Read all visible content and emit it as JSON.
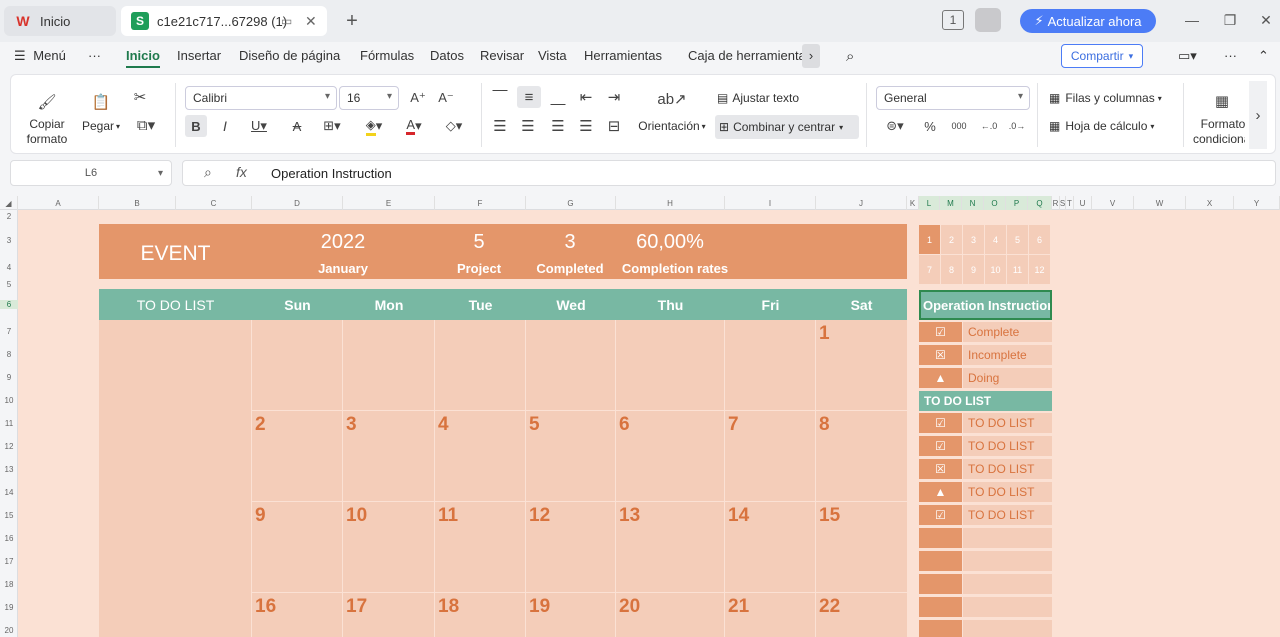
{
  "tabs": {
    "home_label": "Inicio",
    "doc_label": "c1e21c717...67298 (1)",
    "update_label": "Actualizar ahora"
  },
  "menu": {
    "menu_label": "Menú",
    "more": "···",
    "items": [
      "Inicio",
      "Insertar",
      "Diseño de página",
      "Fórmulas",
      "Datos",
      "Revisar",
      "Vista",
      "Herramientas",
      "Caja de herramienta"
    ],
    "share_label": "Compartir"
  },
  "ribbon": {
    "copy_format": "Copiar formato",
    "paste": "Pegar",
    "font_name": "Calibri",
    "font_size": "16",
    "wrap_text": "Ajustar texto",
    "orientation": "Orientación",
    "merge_center": "Combinar y centrar",
    "number_format": "General",
    "rows_cols": "Filas y columnas",
    "worksheet": "Hoja de cálculo",
    "cond_format": "Formato condicional"
  },
  "formula_bar": {
    "cell_ref": "L6",
    "fx": "fx",
    "content": "Operation Instruction"
  },
  "columns": [
    "A",
    "B",
    "C",
    "D",
    "E",
    "F",
    "G",
    "H",
    "I",
    "J",
    "K",
    "L",
    "M",
    "N",
    "O",
    "P",
    "Q",
    "R",
    "S",
    "T",
    "U",
    "V",
    "W",
    "X",
    "Y"
  ],
  "rows": [
    "2",
    "3",
    "4",
    "5",
    "6",
    "7",
    "8",
    "9",
    "10",
    "11",
    "12",
    "13",
    "14",
    "15",
    "16",
    "17",
    "18",
    "19",
    "20"
  ],
  "calendar": {
    "event_label": "EVENT",
    "year": "2022",
    "month": "January",
    "project_count": "5",
    "project_label": "Project",
    "completed_count": "3",
    "completed_label": "Completed",
    "completion_rate": "60,00%",
    "completion_label": "Completion rates",
    "todo_header": "TO DO LIST",
    "days": [
      "Sun",
      "Mon",
      "Tue",
      "Wed",
      "Thu",
      "Fri",
      "Sat"
    ],
    "week1": [
      "",
      "",
      "",
      "",
      "",
      "",
      "1"
    ],
    "week2": [
      "2",
      "3",
      "4",
      "5",
      "6",
      "7",
      "8"
    ],
    "week3": [
      "9",
      "10",
      "11",
      "12",
      "13",
      "14",
      "15"
    ],
    "week4": [
      "16",
      "17",
      "18",
      "19",
      "20",
      "21",
      "22"
    ]
  },
  "month_selector": [
    "1",
    "2",
    "3",
    "4",
    "5",
    "6",
    "7",
    "8",
    "9",
    "10",
    "11",
    "12"
  ],
  "instructions": {
    "header": "Operation Instruction",
    "legend": [
      {
        "icon": "☑",
        "label": "Complete"
      },
      {
        "icon": "☒",
        "label": "Incomplete"
      },
      {
        "icon": "▲",
        "label": "Doing"
      }
    ],
    "todo_header": "TO DO LIST",
    "todo": [
      {
        "icon": "☑",
        "label": "TO DO LIST"
      },
      {
        "icon": "☑",
        "label": "TO DO LIST"
      },
      {
        "icon": "☒",
        "label": "TO DO LIST"
      },
      {
        "icon": "▲",
        "label": "TO DO LIST"
      },
      {
        "icon": "☑",
        "label": "TO DO LIST"
      }
    ]
  },
  "colors": {
    "orange": "#e4966a",
    "teal": "#78b8a3",
    "peach": "#f4cdb9",
    "number": "#d8733e"
  }
}
